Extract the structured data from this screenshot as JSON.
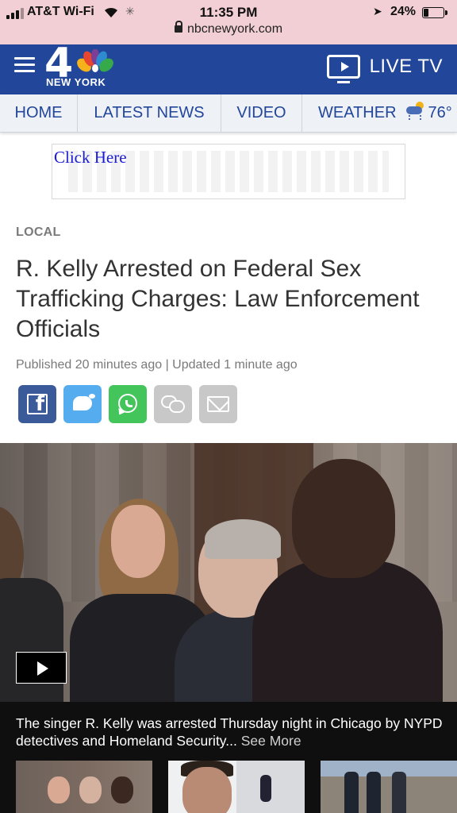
{
  "status_bar": {
    "carrier": "AT&T Wi-Fi",
    "time": "11:35 PM",
    "battery": "24%",
    "url": "nbcnewyork.com"
  },
  "header": {
    "logo_number": "4",
    "logo_city": "NEW YORK",
    "live_tv": "LIVE TV"
  },
  "nav": {
    "tabs": [
      "HOME",
      "LATEST NEWS",
      "VIDEO",
      "WEATHER"
    ],
    "temperature": "76°"
  },
  "ad": {
    "link_text": "Click Here"
  },
  "article": {
    "kicker": "LOCAL",
    "headline": "R. Kelly Arrested on Federal Sex Trafficking Charges: Law Enforcement Officials",
    "meta": "Published 20 minutes ago | Updated 1 minute ago"
  },
  "share": {
    "icons": [
      "facebook-icon",
      "twitter-icon",
      "whatsapp-icon",
      "comment-icon",
      "email-icon"
    ]
  },
  "video": {
    "caption": "The singer R. Kelly was arrested Thursday night in Chicago by NYPD detectives and Homeland Security...",
    "see_more": "See More"
  },
  "colors": {
    "header_blue": "#22469a",
    "status_pink": "#f2cfd4",
    "facebook": "#3b5a9a",
    "twitter": "#55acee",
    "whatsapp": "#43c55c"
  }
}
